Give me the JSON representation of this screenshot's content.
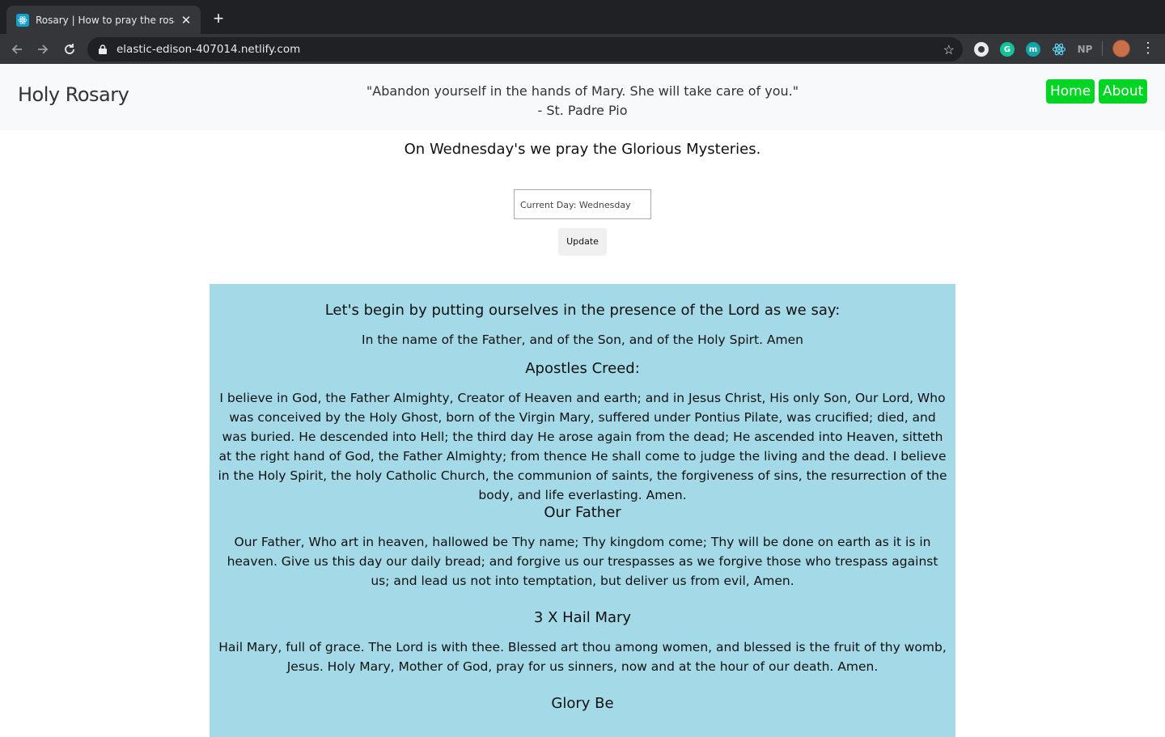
{
  "browser": {
    "tab_title": "Rosary | How to pray the rosary",
    "url": "elastic-edison-407014.netlify.com",
    "extensions": [
      "G",
      "m",
      "NP"
    ]
  },
  "nav": {
    "brand": "Holy Rosary",
    "quote_line1": "\"Abandon yourself in the hands of Mary. She will take care of you.\"",
    "quote_line2": "- St. Padre Pio",
    "home_label": "Home",
    "about_label": "About"
  },
  "main": {
    "day_heading": "On Wednesday's we pray the Glorious Mysteries.",
    "day_input_value": "Current Day: Wednesday",
    "update_label": "Update"
  },
  "prayers": {
    "intro_heading": "Let's begin by putting ourselves in the presence of the Lord as we say:",
    "intro_text": "In the name of the Father, and of the Son, and of the Holy Spirt. Amen",
    "creed_heading": "Apostles Creed:",
    "creed_text": "I believe in God, the Father Almighty, Creator of Heaven and earth; and in Jesus Christ, His only Son, Our Lord, Who was conceived by the Holy Ghost, born of the Virgin Mary, suffered under Pontius Pilate, was crucified; died, and was buried. He descended into Hell; the third day He arose again from the dead; He ascended into Heaven, sitteth at the right hand of God, the Father Almighty; from thence He shall come to judge the living and the dead. I believe in the Holy Spirit, the holy Catholic Church, the communion of saints, the forgiveness of sins, the resurrection of the body, and life everlasting. Amen.",
    "father_heading": "Our Father",
    "father_text": "Our Father, Who art in heaven, hallowed be Thy name; Thy kingdom come; Thy will be done on earth as it is in heaven. Give us this day our daily bread; and forgive us our trespasses as we forgive those who trespass against us; and lead us not into temptation, but deliver us from evil, Amen.",
    "hail_heading": "3 X Hail Mary",
    "hail_text": "Hail Mary, full of grace. The Lord is with thee. Blessed art thou among women, and blessed is the fruit of thy womb, Jesus. Holy Mary, Mother of God, pray for us sinners, now and at the hour of our death. Amen.",
    "glory_heading": "Glory Be"
  },
  "colors": {
    "nav_button": "#00d524",
    "prayer_box": "#a4dae7",
    "navbar_bg": "#f8f9fa"
  }
}
